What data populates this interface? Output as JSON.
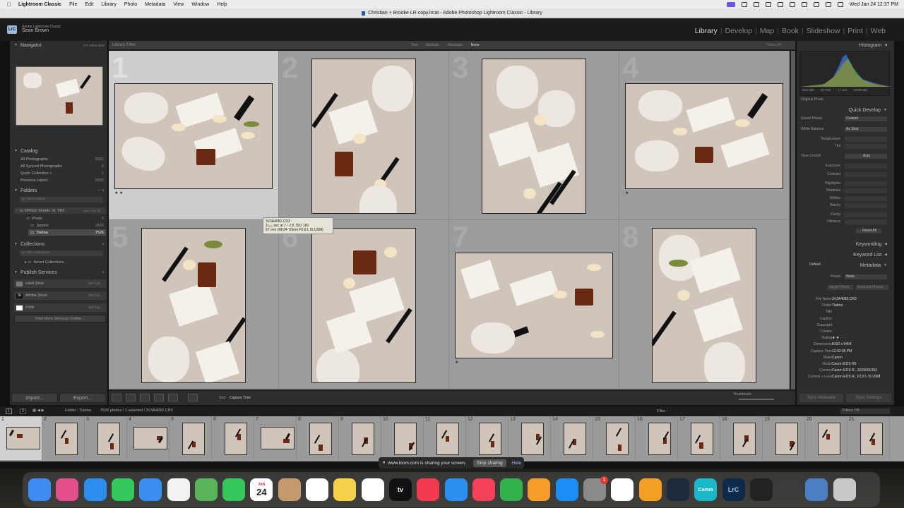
{
  "menubar": {
    "apple": "",
    "app_name": "Lightroom Classic",
    "items": [
      "File",
      "Edit",
      "Library",
      "Photo",
      "Metadata",
      "View",
      "Window",
      "Help"
    ],
    "datetime": "Wed Jan 24  12:37 PM"
  },
  "window_title": "Christian + Brooke LR copy.lrcat - Adobe Photoshop Lightroom Classic - Library",
  "identity": {
    "logo": "LrC",
    "product": "Adobe Lightroom Classic",
    "user": "Sean Brown"
  },
  "modules": [
    "Library",
    "Develop",
    "Map",
    "Book",
    "Slideshow",
    "Print",
    "Web"
  ],
  "active_module": "Library",
  "left_panel": {
    "navigator": {
      "title": "Navigator",
      "zoom": "FIT  100%  50%"
    },
    "catalog": {
      "title": "Catalog",
      "items": [
        {
          "label": "All Photographs",
          "count": "9952"
        },
        {
          "label": "All Synced Photographs",
          "count": "0"
        },
        {
          "label": "Quick Collection +",
          "count": "1"
        },
        {
          "label": "Previous Import",
          "count": "9952"
        }
      ]
    },
    "folders": {
      "title": "Folders",
      "filter_placeholder": "Q- Filter Folders",
      "volume": {
        "label": "G-SPEED Shuttle XL TB3",
        "info": "44.1 / 111 TB"
      },
      "items": [
        {
          "label": "Photo",
          "count": "0"
        },
        {
          "label": "Jasmin",
          "count": "2426"
        },
        {
          "label": "Tiahna",
          "count": "7526"
        }
      ]
    },
    "collections": {
      "title": "Collections",
      "filter_placeholder": "Q- Filter Collections",
      "items": [
        {
          "label": "Smart Collections"
        }
      ]
    },
    "publish_services": {
      "title": "Publish Services",
      "items": [
        {
          "label": "Hard Drive",
          "action": "Set Up..."
        },
        {
          "label": "Adobe Stock",
          "action": "Set Up..."
        },
        {
          "label": "Flickr",
          "action": "Set Up..."
        }
      ],
      "find_more": "Find More Services Online..."
    },
    "import_label": "Import...",
    "export_label": "Export..."
  },
  "center": {
    "filter_title": "Library Filter",
    "filter_options": [
      "Text",
      "Attribute",
      "Metadata",
      "None"
    ],
    "filter_active": "None",
    "filters_off": "Filters Off",
    "cells": [
      {
        "num": "1",
        "stars": "★ ★",
        "orientation": "landscape",
        "selected": true
      },
      {
        "num": "2",
        "stars": "",
        "orientation": "portrait",
        "selected": false
      },
      {
        "num": "3",
        "stars": "",
        "orientation": "portrait",
        "selected": false
      },
      {
        "num": "4",
        "stars": "★",
        "orientation": "landscape",
        "selected": false
      },
      {
        "num": "5",
        "stars": "",
        "orientation": "portrait",
        "selected": false
      },
      {
        "num": "6",
        "stars": "",
        "orientation": "portrait",
        "selected": false
      },
      {
        "num": "7",
        "stars": "★",
        "orientation": "landscape",
        "selected": false
      },
      {
        "num": "8",
        "stars": "",
        "orientation": "portrait",
        "selected": false
      }
    ],
    "tooltip": {
      "line1": "3V3A4082.CR3",
      "line2": "1/₁₀₀ sec at ƒ / 2.8, ISO 160",
      "line3": "57 mm (RF24-70mm F2.8 L IS USM)"
    },
    "toolbar": {
      "sort_label": "Sort:",
      "sort_value": "Capture Time",
      "thumbnails_label": "Thumbnails"
    }
  },
  "right_panel": {
    "histogram": {
      "title": "Histogram",
      "iso": "ISO 160",
      "focal": "57 mm",
      "aperture": "ƒ / 2.8",
      "shutter": "1/100 sec",
      "original_photo": "Original Photo"
    },
    "quick_develop": {
      "title": "Quick Develop",
      "saved_preset_label": "Saved Preset",
      "saved_preset_value": "Custom",
      "white_balance_label": "White Balance",
      "white_balance_value": "As Shot",
      "temperature": "Temperature",
      "tint": "Tint",
      "tone_control": "Tone Control",
      "auto": "Auto",
      "sliders": [
        "Exposure",
        "Contrast",
        "Highlights",
        "Shadows",
        "Whites",
        "Blacks",
        "Clarity",
        "Vibrance"
      ],
      "reset_all": "Reset All"
    },
    "keywording": "Keywording",
    "keyword_list": "Keyword List",
    "metadata": {
      "title": "Metadata",
      "preset_default": "Default",
      "preset_label": "Preset",
      "preset_value": "None",
      "target_photo": "Target Photo",
      "selected_photos": "Selected Photos",
      "fields": [
        {
          "label": "File Name",
          "value": "3V3A4082.CR3"
        },
        {
          "label": "Folder",
          "value": "Tiahna"
        },
        {
          "label": "Title",
          "value": ""
        },
        {
          "label": "Caption",
          "value": ""
        },
        {
          "label": "Copyright",
          "value": ""
        },
        {
          "label": "Creator",
          "value": ""
        },
        {
          "label": "Rating",
          "value": "★ ★ · · ·"
        },
        {
          "label": "Dimensions",
          "value": "8192 x 5464"
        },
        {
          "label": "Capture Time",
          "value": "12:02:06 PM"
        },
        {
          "label": "Make",
          "value": "Canon"
        },
        {
          "label": "Model",
          "value": "Canon EOS R5"
        },
        {
          "label": "Camera",
          "value": "Canon EOS R...2029001393"
        },
        {
          "label": "Camera + Lens",
          "value": "Canon EOS R...F2.8 L IS USM"
        }
      ]
    },
    "sync_metadata": "Sync Metadata",
    "sync_settings": "Sync Settings"
  },
  "filmstrip": {
    "views": [
      "1",
      "2"
    ],
    "folder_info": "Folder : Tiahna",
    "count_info": "7526 photos / 1 selected / 3V3A4082.CR3",
    "filter_label": "Filter :",
    "filters_off": "Filters Off",
    "frames": [
      "1",
      "2",
      "3",
      "4",
      "5",
      "6",
      "7",
      "8",
      "9",
      "10",
      "11",
      "12",
      "13",
      "14",
      "15",
      "16",
      "17",
      "18",
      "19",
      "20",
      "21"
    ]
  },
  "loom_bar": {
    "message": "www.loom.com is sharing your screen.",
    "stop_label": "Stop sharing",
    "hide_label": "Hide"
  },
  "dock": {
    "calendar_month": "JAN",
    "calendar_day": "24",
    "settings_badge": "1",
    "apps": [
      {
        "name": "Finder",
        "color": "#3d8bf0"
      },
      {
        "name": "Launchpad",
        "color": "#e34f8b"
      },
      {
        "name": "Safari",
        "color": "#2d8cf0"
      },
      {
        "name": "Messages",
        "color": "#34c759"
      },
      {
        "name": "Mail",
        "color": "#3a8ef0"
      },
      {
        "name": "Photos",
        "color": "#f2f2f2"
      },
      {
        "name": "Maps",
        "color": "#58b35a"
      },
      {
        "name": "FaceTime",
        "color": "#34c759"
      },
      {
        "name": "Calendar",
        "color": "#ffffff"
      },
      {
        "name": "Contacts",
        "color": "#c49a6c"
      },
      {
        "name": "Reminders",
        "color": "#ffffff"
      },
      {
        "name": "Notes",
        "color": "#f6d24c"
      },
      {
        "name": "Freeform",
        "color": "#ffffff"
      },
      {
        "name": "TV",
        "color": "#111111"
      },
      {
        "name": "News",
        "color": "#f33b4f"
      },
      {
        "name": "Keynote",
        "color": "#2a8ff0"
      },
      {
        "name": "Music",
        "color": "#f5405a"
      },
      {
        "name": "Numbers",
        "color": "#31b24a"
      },
      {
        "name": "Pages",
        "color": "#f59c2a"
      },
      {
        "name": "App Store",
        "color": "#1a8ef5"
      },
      {
        "name": "System Settings",
        "color": "#8a8a8a"
      },
      {
        "name": "Chrome",
        "color": "#ffffff"
      },
      {
        "name": "Bridge",
        "color": "#f39f24"
      },
      {
        "name": "Affinity",
        "color": "#1d2a3b"
      },
      {
        "name": "Canva",
        "color": "#19b8c9"
      },
      {
        "name": "Lightroom Classic",
        "color": "#0e2a4a"
      },
      {
        "name": "iPhone Mirroring",
        "color": "#222222"
      },
      {
        "name": "Downloads",
        "color": "#3b3b3b"
      },
      {
        "name": "Folder",
        "color": "#4a7fc4"
      },
      {
        "name": "Trash",
        "color": "#c9c9c9"
      }
    ],
    "tv_label": "tv",
    "canva_label": "Canva",
    "lrc_label": "LrC"
  }
}
